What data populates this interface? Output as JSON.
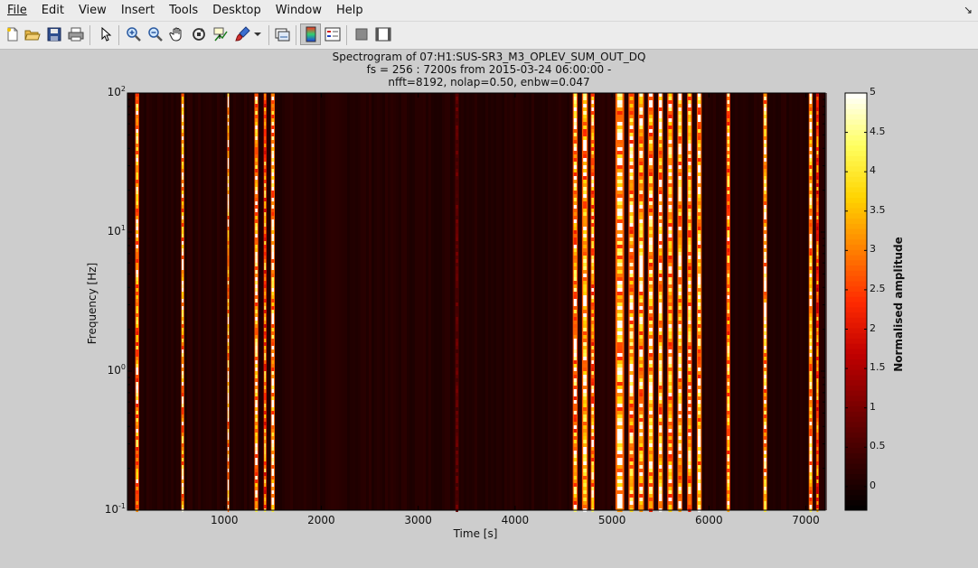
{
  "menubar": {
    "items": [
      {
        "label": "File"
      },
      {
        "label": "Edit"
      },
      {
        "label": "View"
      },
      {
        "label": "Insert"
      },
      {
        "label": "Tools"
      },
      {
        "label": "Desktop"
      },
      {
        "label": "Window"
      },
      {
        "label": "Help"
      }
    ],
    "dock_glyph": "↘"
  },
  "toolbar": {
    "buttons": [
      {
        "icon": "new-figure-icon"
      },
      {
        "icon": "open-file-icon"
      },
      {
        "icon": "save-icon"
      },
      {
        "icon": "print-icon"
      },
      {
        "icon": "edit-plot-arrow-icon"
      },
      {
        "icon": "zoom-in-icon"
      },
      {
        "icon": "zoom-out-icon"
      },
      {
        "icon": "pan-hand-icon"
      },
      {
        "icon": "rotate-3d-icon"
      },
      {
        "icon": "data-cursor-icon"
      },
      {
        "icon": "brush-icon"
      },
      {
        "icon": "link-plot-icon"
      },
      {
        "icon": "colorbar-toggle-icon"
      },
      {
        "icon": "legend-toggle-icon"
      },
      {
        "icon": "hide-plot-tools-icon"
      },
      {
        "icon": "show-plot-tools-icon"
      }
    ]
  },
  "figure": {
    "title_line1": "Spectrogram of 07:H1:SUS-SR3_M3_OPLEV_SUM_OUT_DQ",
    "title_line2": "fs = 256 : 7200s from 2015-03-24 06:00:00 -",
    "title_line3": "nfft=8192, nolap=0.50, enbw=0.047"
  },
  "colors": {
    "background": "#cdcdcd",
    "chrome": "#ececec",
    "colormap": [
      "#000000",
      "#3a0000",
      "#7a0000",
      "#c00000",
      "#ff2a00",
      "#ff8000",
      "#ffd400",
      "#ffff60",
      "#ffffff"
    ]
  },
  "chart_data": {
    "type": "heatmap",
    "title": "Spectrogram of 07:H1:SUS-SR3_M3_OPLEV_SUM_OUT_DQ",
    "xlabel": "Time [s]",
    "ylabel": "Frequency [Hz]",
    "xlim": [
      0,
      7200
    ],
    "ylim": [
      0.1,
      100
    ],
    "yscale": "log",
    "x_ticks": [
      1000,
      2000,
      3000,
      4000,
      5000,
      6000,
      7000
    ],
    "x_tick_labels": [
      "1000",
      "2000",
      "3000",
      "4000",
      "5000",
      "6000",
      "7000"
    ],
    "y_ticks": [
      0.1,
      1,
      10,
      100
    ],
    "y_tick_labels": [
      {
        "base": "10",
        "exp": "-1"
      },
      {
        "base": "10",
        "exp": "0"
      },
      {
        "base": "10",
        "exp": "1"
      },
      {
        "base": "10",
        "exp": "2"
      }
    ],
    "background_level": 0.1,
    "events": [
      {
        "t": 100,
        "w": 40,
        "level": 4.6
      },
      {
        "t": 570,
        "w": 30,
        "level": 5
      },
      {
        "t": 1040,
        "w": 20,
        "level": 5
      },
      {
        "t": 1330,
        "w": 40,
        "level": 4.8
      },
      {
        "t": 1420,
        "w": 30,
        "level": 3.8
      },
      {
        "t": 1500,
        "w": 40,
        "level": 5
      },
      {
        "t": 3400,
        "w": 40,
        "level": 0.9
      },
      {
        "t": 4620,
        "w": 50,
        "level": 4.8
      },
      {
        "t": 4720,
        "w": 60,
        "level": 5
      },
      {
        "t": 4800,
        "w": 40,
        "level": 4.5
      },
      {
        "t": 5080,
        "w": 90,
        "level": 5
      },
      {
        "t": 5200,
        "w": 60,
        "level": 4.8
      },
      {
        "t": 5300,
        "w": 60,
        "level": 5
      },
      {
        "t": 5400,
        "w": 60,
        "level": 4.8
      },
      {
        "t": 5500,
        "w": 50,
        "level": 5
      },
      {
        "t": 5600,
        "w": 60,
        "level": 4.6
      },
      {
        "t": 5700,
        "w": 50,
        "level": 5
      },
      {
        "t": 5800,
        "w": 50,
        "level": 4.6
      },
      {
        "t": 5900,
        "w": 50,
        "level": 5
      },
      {
        "t": 6200,
        "w": 40,
        "level": 4.4
      },
      {
        "t": 6580,
        "w": 40,
        "level": 5
      },
      {
        "t": 7050,
        "w": 40,
        "level": 5
      },
      {
        "t": 7120,
        "w": 30,
        "level": 3.5
      }
    ],
    "colorbar": {
      "label": "Normalised amplitude",
      "clim": [
        -0.3,
        5
      ],
      "ticks": [
        0,
        0.5,
        1,
        1.5,
        2,
        2.5,
        3,
        3.5,
        4,
        4.5,
        5
      ],
      "tick_labels": [
        "0",
        "0.5",
        "1",
        "1.5",
        "2",
        "2.5",
        "3",
        "3.5",
        "4",
        "4.5",
        "5"
      ]
    },
    "grid": false,
    "legend": "none"
  }
}
